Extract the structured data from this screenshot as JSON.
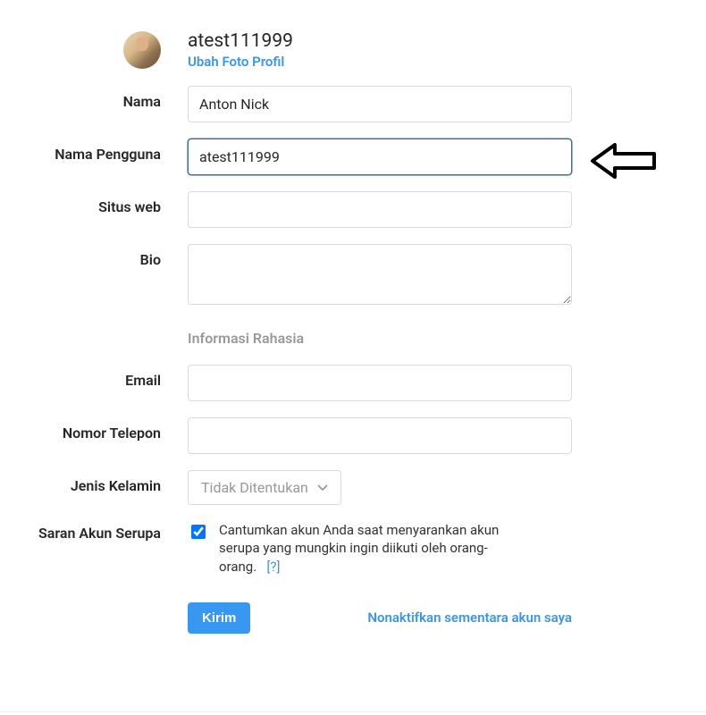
{
  "header": {
    "username": "atest111999",
    "change_photo": "Ubah Foto Profil"
  },
  "labels": {
    "name": "Nama",
    "username": "Nama Pengguna",
    "website": "Situs web",
    "bio": "Bio",
    "private_info": "Informasi Rahasia",
    "email": "Email",
    "phone": "Nomor Telepon",
    "gender": "Jenis Kelamin",
    "similar_accounts": "Saran Akun Serupa"
  },
  "fields": {
    "name_value": "Anton Nick",
    "username_value": "atest111999",
    "website_value": "",
    "bio_value": "",
    "email_value": "",
    "phone_value": "",
    "gender_selected": "Tidak Ditentukan"
  },
  "similar_accounts": {
    "checked": true,
    "text_part1": "Cantumkan akun Anda saat menyarankan akun serupa yang mungkin ingin diikuti oleh orang-orang.",
    "help": "[?]"
  },
  "actions": {
    "submit": "Kirim",
    "deactivate": "Nonaktifkan sementara akun saya"
  },
  "colors": {
    "link": "#3897f0",
    "border": "#dbdbdb",
    "focus_border": "#3a6ea5"
  },
  "icons": {
    "chevron_down": "chevron-down-icon",
    "arrow_left": "arrow-left-icon"
  }
}
